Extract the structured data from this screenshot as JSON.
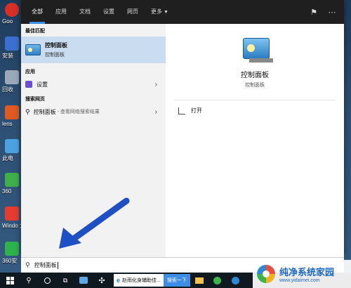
{
  "desktop": {
    "icons": [
      {
        "label": "Goo"
      },
      {
        "label": "安装"
      },
      {
        "label": "回收"
      },
      {
        "label": "lens"
      },
      {
        "label": "此电"
      },
      {
        "label": "360"
      },
      {
        "label": "Windo 大师"
      },
      {
        "label": "360安"
      }
    ]
  },
  "tabs": [
    "全部",
    "应用",
    "文档",
    "设置",
    "网页",
    "更多"
  ],
  "left": {
    "best_match_header": "最佳匹配",
    "best_match_title": "控制面板",
    "best_match_sub": "控制面板",
    "apps_header": "应用",
    "settings_label": "设置",
    "web_header": "搜索网页",
    "web_query": "控制面板",
    "web_hint": "- 查看网络搜索结果"
  },
  "right": {
    "title": "控制面板",
    "subtitle": "控制面板",
    "open_label": "打开"
  },
  "search": {
    "value": "控制面板"
  },
  "taskbar": {
    "app_label": "赵雨化身辅助佳...",
    "search_btn": "搜索一下"
  },
  "watermark": {
    "title": "纯净系统家园",
    "url": "www.yidaimei.com"
  },
  "colors": {
    "tab_accent": "#3a8ee6",
    "best_match_bg": "#c9dcf0",
    "arrow": "#1f4fc4"
  }
}
